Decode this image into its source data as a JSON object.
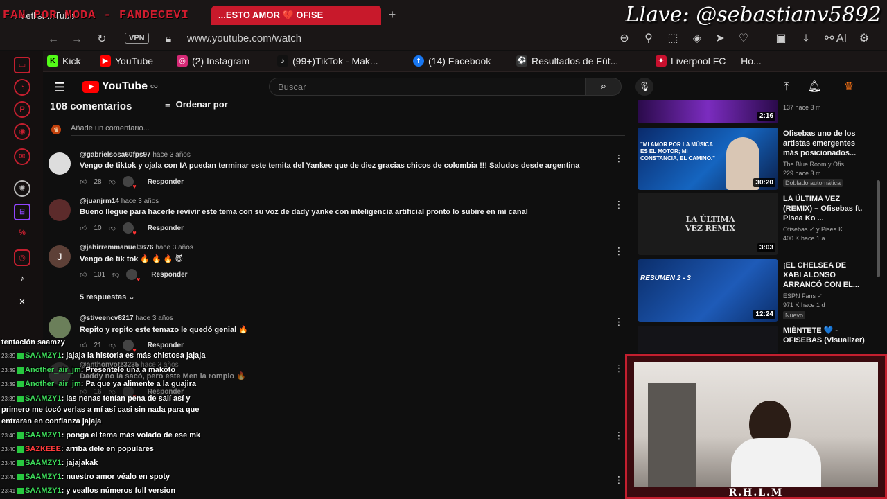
{
  "overlay": {
    "title": "FAN POR MODA - FANDECEVI",
    "streamer_key": "Llave: @sebastianv5892"
  },
  "browser": {
    "tab_left": "...setlist ...Tube",
    "tab_active": "...ESTO AMOR 💔 OFISE",
    "tab_new": "+",
    "vpn": "VPN",
    "url": "www.youtube.com/watch",
    "ai_label": "AI"
  },
  "bookmarks": [
    {
      "label": "Kick",
      "icon": "K",
      "color": "#53fc18"
    },
    {
      "label": "YouTube",
      "icon": "▶",
      "color": "#ff0000"
    },
    {
      "label": "(2) Instagram",
      "icon": "◎",
      "color": "#d62976"
    },
    {
      "label": "(99+)TikTok - Mak...",
      "icon": "♪",
      "color": "#111111"
    },
    {
      "label": "(14) Facebook",
      "icon": "f",
      "color": "#1877f2"
    },
    {
      "label": "Resultados de Fút...",
      "icon": "⚽",
      "color": "#333333"
    },
    {
      "label": "Liverpool FC — Ho...",
      "icon": "✦",
      "color": "#c8102e"
    }
  ],
  "youtube": {
    "logo": "YouTube",
    "logo_sup": "CO",
    "search_placeholder": "Buscar",
    "comments_count": "108 comentarios",
    "sort_label": "Ordenar por",
    "add_comment": "Añade un comentario...",
    "replies_toggle": "5 respuestas",
    "reply_label": "Responder"
  },
  "comments": [
    {
      "author": "@gabrielsosa60fps97",
      "time": "hace 3 años",
      "text": "Vengo de tiktok y ojala con IA puedan terminar este temita del Yankee que de diez gracias chicos de colombia !!! Saludos desde argentina",
      "likes": "28",
      "avatar": ""
    },
    {
      "author": "@juanjrm14",
      "time": "hace 3 años",
      "text": "Bueno llegue para hacerle revivir este tema  con su voz de dady yanke con inteligencia artificial pronto lo subire en mi canal",
      "likes": "10",
      "avatar": ""
    },
    {
      "author": "@jahirremmanuel3676",
      "time": "hace 3 años",
      "text": "Vengo de tik tok 🔥 🔥 🔥 😈",
      "likes": "101",
      "avatar": "J"
    },
    {
      "author": "@stiveencv8217",
      "time": "hace 3 años",
      "text": "Repito y repito este temazo  le quedó genial 🔥",
      "likes": "21",
      "avatar": ""
    },
    {
      "author": "@anthonyotz3235",
      "time": "hace 3 años",
      "text": "Daddy no la sacó, pero este Men la rompio 🔥",
      "likes": "16",
      "avatar": ""
    }
  ],
  "related": [
    {
      "title": "",
      "meta1": "137  hace 3 m",
      "meta2": "",
      "duration": "2:16",
      "badge": ""
    },
    {
      "title": "Ofisebas uno de los artistas emergentes más posicionados...",
      "meta1": "The Blue Room y Ofis...",
      "meta2": "229  hace 3 m",
      "duration": "30:20",
      "badge": "Doblado automática",
      "thumb_text": "\"MI AMOR POR LA MÚSICA ES EL MOTOR; MI CONSTANCIA, EL CAMINO.\""
    },
    {
      "title": "LA ÚLTIMA VEZ (REMIX) – Ofisebas ft. Pisea Ko ...",
      "meta1": "Ofisebas ✓ y Pisea K...",
      "meta2": "400 K  hace 1 a",
      "duration": "3:03",
      "badge": "",
      "thumb_text": "LA ÚLTIMA VEZ REMIX"
    },
    {
      "title": "¡EL CHELSEA DE XABI ALONSO ARRANCÓ CON EL...",
      "meta1": "ESPN Fans ✓",
      "meta2": "971 K  hace 1 d",
      "duration": "12:24",
      "badge": "Nuevo",
      "thumb_text": "RESUMEN 2 - 3"
    },
    {
      "title": "MIÉNTETE 💙 - OFISEBAS (Visualizer)",
      "meta1": "",
      "meta2": "",
      "duration": "",
      "badge": ""
    }
  ],
  "chat": [
    {
      "time": "",
      "user": "",
      "text": "tentación saamzy"
    },
    {
      "time": "23:39",
      "user": "SAAMZY1",
      "text": ": jajaja la historia es más chistosa jajaja"
    },
    {
      "time": "23:39",
      "user": "Another_air_jm",
      "text": ": Presentele una a makoto"
    },
    {
      "time": "23:39",
      "user": "Another_air_jm",
      "text": ": Pa que ya alimente a la guajira"
    },
    {
      "time": "23:39",
      "user": "SAAMZY1",
      "text": ": las nenas tenían pena de salí así y"
    },
    {
      "time": "",
      "user": "",
      "text": "primero me tocó verlas a mí así casi sin nada para que"
    },
    {
      "time": "",
      "user": "",
      "text": "entraran en confianza jajaja"
    },
    {
      "time": "23:40",
      "user": "SAAMZY1",
      "text": ": ponga el tema más volado de ese mk"
    },
    {
      "time": "23:40",
      "user": "SAZKEEE",
      "text": ": arriba dele en populares"
    },
    {
      "time": "23:40",
      "user": "SAAMZY1",
      "text": ": jajajakak"
    },
    {
      "time": "23:40",
      "user": "SAAMZY1",
      "text": ": nuestro amor véalo en spoty"
    },
    {
      "time": "23:41",
      "user": "SAAMZY1",
      "text": ": y veallos números  full version"
    }
  ],
  "webcam": {
    "label": "R.H.L.M"
  }
}
